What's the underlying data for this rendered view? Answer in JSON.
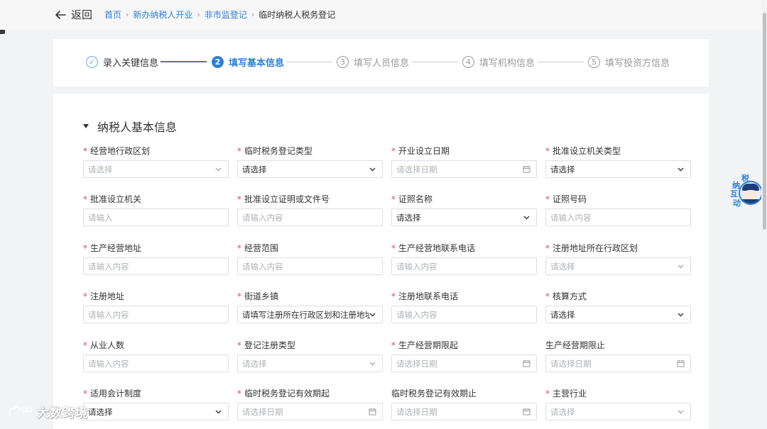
{
  "header": {
    "back_label": "返回",
    "breadcrumb": {
      "home": "首页",
      "level1": "新办纳税人开业",
      "level2": "非市监登记",
      "current": "临时纳税人税务登记",
      "separator": "›"
    }
  },
  "steps": {
    "items": [
      {
        "index": "✓",
        "label": "录入关键信息",
        "state": "done"
      },
      {
        "index": "2",
        "label": "填写基本信息",
        "state": "active"
      },
      {
        "index": "3",
        "label": "填写人员信息",
        "state": "todo"
      },
      {
        "index": "4",
        "label": "填写机构信息",
        "state": "todo"
      },
      {
        "index": "5",
        "label": "填写投资方信息",
        "state": "todo"
      }
    ]
  },
  "section": {
    "title": "纳税人基本信息"
  },
  "fields": [
    {
      "label": "经营地行政区划",
      "required": true,
      "value": "请选择",
      "filled": false,
      "type": "select"
    },
    {
      "label": "临时税务登记类型",
      "required": true,
      "value": "请选择",
      "filled": true,
      "type": "select-dark"
    },
    {
      "label": "开业设立日期",
      "required": true,
      "value": "请选择日期",
      "filled": false,
      "type": "date"
    },
    {
      "label": "批准设立机关类型",
      "required": true,
      "value": "请选择",
      "filled": true,
      "type": "select-dark"
    },
    {
      "label": "批准设立机关",
      "required": true,
      "value": "请输入",
      "filled": false,
      "type": "text"
    },
    {
      "label": "批准设立证明或文件号",
      "required": true,
      "value": "请输入内容",
      "filled": false,
      "type": "text"
    },
    {
      "label": "证照名称",
      "required": true,
      "value": "请选择",
      "filled": true,
      "type": "select-dark"
    },
    {
      "label": "证照号码",
      "required": true,
      "value": "请输入内容",
      "filled": false,
      "type": "text"
    },
    {
      "label": "生产经营地址",
      "required": true,
      "value": "请输入内容",
      "filled": false,
      "type": "text"
    },
    {
      "label": "经营范围",
      "required": true,
      "value": "请输入内容",
      "filled": false,
      "type": "text"
    },
    {
      "label": "生产经营地联系电话",
      "required": true,
      "value": "请输入内容",
      "filled": false,
      "type": "text"
    },
    {
      "label": "注册地址所在行政区划",
      "required": true,
      "value": "请选择",
      "filled": false,
      "type": "select"
    },
    {
      "label": "注册地址",
      "required": true,
      "value": "请输入内容",
      "filled": false,
      "type": "text"
    },
    {
      "label": "街道乡镇",
      "required": true,
      "value": "请填写注册所在行政区划和注册地址",
      "filled": true,
      "type": "select-dark"
    },
    {
      "label": "注册地联系电话",
      "required": true,
      "value": "请输入内容",
      "filled": false,
      "type": "text"
    },
    {
      "label": "核算方式",
      "required": true,
      "value": "请选择",
      "filled": true,
      "type": "select-dark"
    },
    {
      "label": "从业人数",
      "required": true,
      "value": "请输入内容",
      "filled": false,
      "type": "text"
    },
    {
      "label": "登记注册类型",
      "required": true,
      "value": "请选择",
      "filled": false,
      "type": "select"
    },
    {
      "label": "生产经营期限起",
      "required": true,
      "value": "请选择日期",
      "filled": false,
      "type": "date"
    },
    {
      "label": "生产经营期限止",
      "required": false,
      "value": "请选择日期",
      "filled": false,
      "type": "date"
    },
    {
      "label": "适用会计制度",
      "required": true,
      "value": "请选择",
      "filled": true,
      "type": "select-dark"
    },
    {
      "label": "临时税务登记有效期起",
      "required": true,
      "value": "请选择日期",
      "filled": false,
      "type": "date"
    },
    {
      "label": "临时税务登记有效期止",
      "required": false,
      "value": "请选择日期",
      "filled": false,
      "type": "date"
    },
    {
      "label": "主营行业",
      "required": true,
      "value": "请选择",
      "filled": false,
      "type": "select"
    }
  ],
  "required_mark": "*",
  "float_help": {
    "chars": [
      "纳",
      "税",
      "互",
      "动"
    ]
  },
  "watermark": {
    "text": "大数跨境"
  },
  "colors": {
    "accent": "#2f7fd8",
    "required": "#e34b4b",
    "border": "#dcdfe6",
    "placeholder": "#b0b3b8"
  }
}
